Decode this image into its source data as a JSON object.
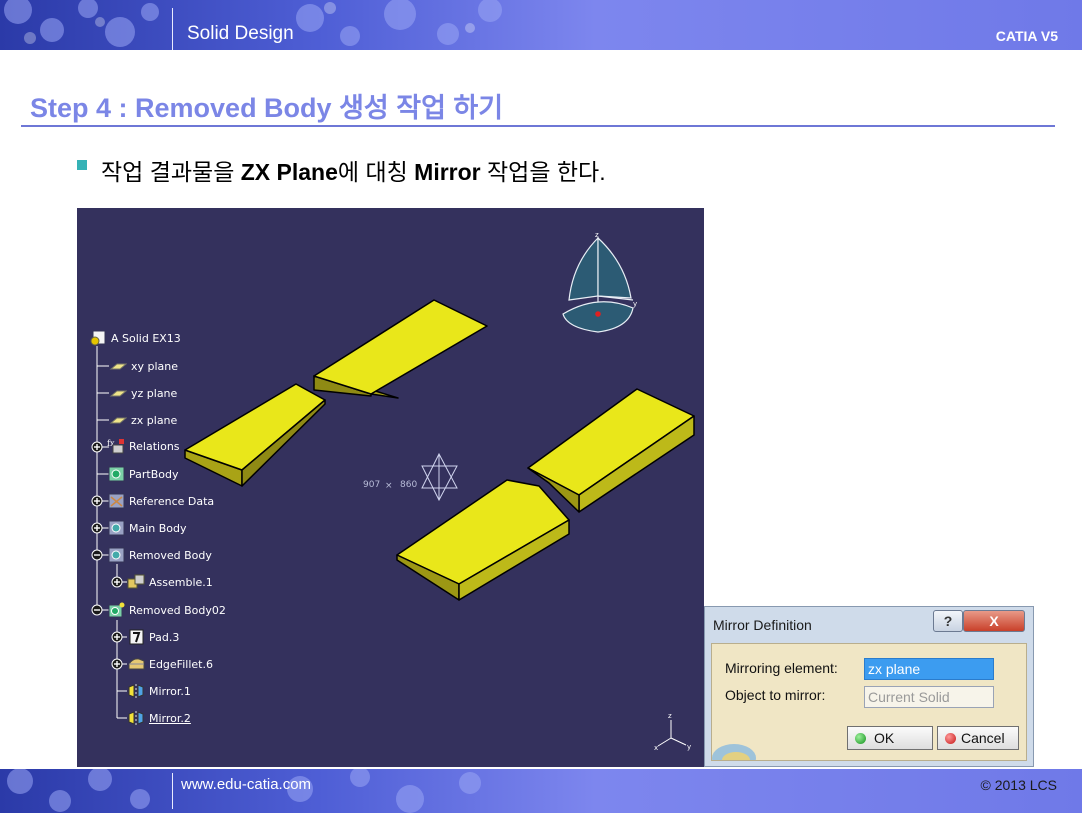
{
  "header": {
    "title": "Solid Design",
    "brand": "CATIA V5"
  },
  "page": {
    "title": "Step 4 : Removed Body 생성 작업 하기",
    "instruction": {
      "part1": "작업 결과물을 ",
      "plane": "ZX Plane",
      "part2": "에 대칭 ",
      "mirror": "Mirror",
      "part3": " 작업을 한다."
    }
  },
  "tree": {
    "items": [
      {
        "label": "A Solid EX13",
        "icon": "part-icon"
      },
      {
        "label": "xy plane",
        "icon": "plane-icon"
      },
      {
        "label": "yz plane",
        "icon": "plane-icon"
      },
      {
        "label": "zx plane",
        "icon": "plane-icon"
      },
      {
        "label": "Relations",
        "icon": "relations-icon"
      },
      {
        "label": "PartBody",
        "icon": "body-icon"
      },
      {
        "label": "Reference Data",
        "icon": "body-icon"
      },
      {
        "label": "Main Body",
        "icon": "body-icon"
      },
      {
        "label": "Removed Body",
        "icon": "body-icon"
      },
      {
        "label": "Assemble.1",
        "icon": "assemble-icon"
      },
      {
        "label": "Removed Body02",
        "icon": "body-icon"
      },
      {
        "label": "Pad.3",
        "icon": "pad-icon"
      },
      {
        "label": "EdgeFillet.6",
        "icon": "fillet-icon"
      },
      {
        "label": "Mirror.1",
        "icon": "mirror-icon"
      },
      {
        "label": "Mirror.2",
        "icon": "mirror-icon"
      }
    ]
  },
  "viewport": {
    "coord_x": "907",
    "coord_y": "860",
    "compass_axes": {
      "z": "z",
      "y": "y"
    },
    "mini_axes": {
      "z": "z",
      "x": "x",
      "y": "y"
    },
    "colors": {
      "background": "#34315d",
      "solid": "#e9e71a"
    }
  },
  "dialog": {
    "title": "Mirror Definition",
    "help_label": "?",
    "close_label": "X",
    "mirroring_label": "Mirroring element:",
    "mirroring_value": "zx plane",
    "object_label": "Object to mirror:",
    "object_value": "Current Solid",
    "ok_label": "OK",
    "cancel_label": "Cancel"
  },
  "footer": {
    "url": "www.edu-catia.com",
    "copyright": "© 2013 LCS"
  }
}
